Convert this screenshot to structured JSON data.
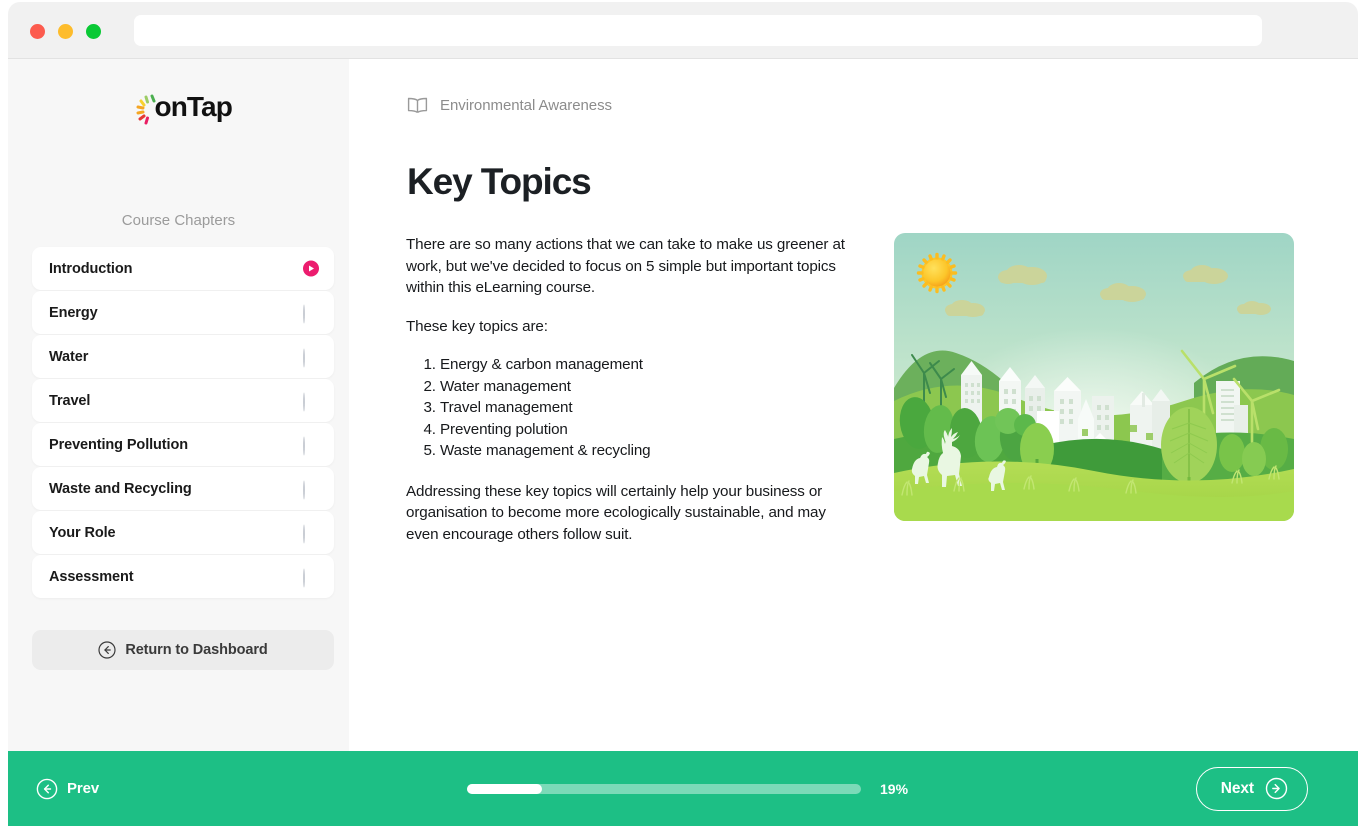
{
  "browser": {
    "traffic_lights": [
      "close-red",
      "minimize-yellow",
      "maximize-green"
    ],
    "url_value": "",
    "url_placeholder": ""
  },
  "sidebar": {
    "logo_text": "onTap",
    "logo_colors": [
      "#f5a623",
      "#f8d12f",
      "#4caf50",
      "#e91e63",
      "#e53935",
      "#9ccc65"
    ],
    "section_label": "Course Chapters",
    "items": [
      {
        "label": "Introduction",
        "status": "playing"
      },
      {
        "label": "Energy",
        "status": "incomplete"
      },
      {
        "label": "Water",
        "status": "incomplete"
      },
      {
        "label": "Travel",
        "status": "incomplete"
      },
      {
        "label": "Preventing Pollution",
        "status": "incomplete"
      },
      {
        "label": "Waste and Recycling",
        "status": "incomplete"
      },
      {
        "label": "Your Role",
        "status": "incomplete"
      },
      {
        "label": "Assessment",
        "status": "incomplete"
      }
    ],
    "return_button": {
      "label": "Return to Dashboard",
      "icon": "arrow-left-circle-icon"
    }
  },
  "main": {
    "breadcrumb": {
      "icon": "open-book-icon",
      "label": "Environmental Awareness"
    },
    "title": "Key Topics",
    "paragraph_1": "There are so many actions that we can take to make us greener at work, but we've decided to focus on 5 simple but important topics within this eLearning course.",
    "paragraph_2": "These key topics are:",
    "list": [
      "Energy & carbon management",
      "Water management",
      "Travel management",
      "Preventing polution",
      "Waste management & recycling"
    ],
    "paragraph_3": "Addressing these key topics will certainly help your business or organisation to become more ecologically sustainable, and may even encourage others follow suit.",
    "illustration": {
      "name": "eco-city-papercut-illustration",
      "description": "Paper-cut style green city with sun, clouds, hills, buildings, trees, deer and wind turbines",
      "sky_top_color": "#a7d9c9",
      "sky_bottom_color": "#dff0cf",
      "sun_color": "#fbb713",
      "grass_color": "#aadd4a"
    }
  },
  "footer": {
    "prev_label": "Prev",
    "prev_icon": "arrow-left-circle-icon",
    "next_label": "Next",
    "next_icon": "arrow-right-circle-icon",
    "progress_percent": 19,
    "progress_label": "19%",
    "bar_color": "#1dbf85"
  }
}
